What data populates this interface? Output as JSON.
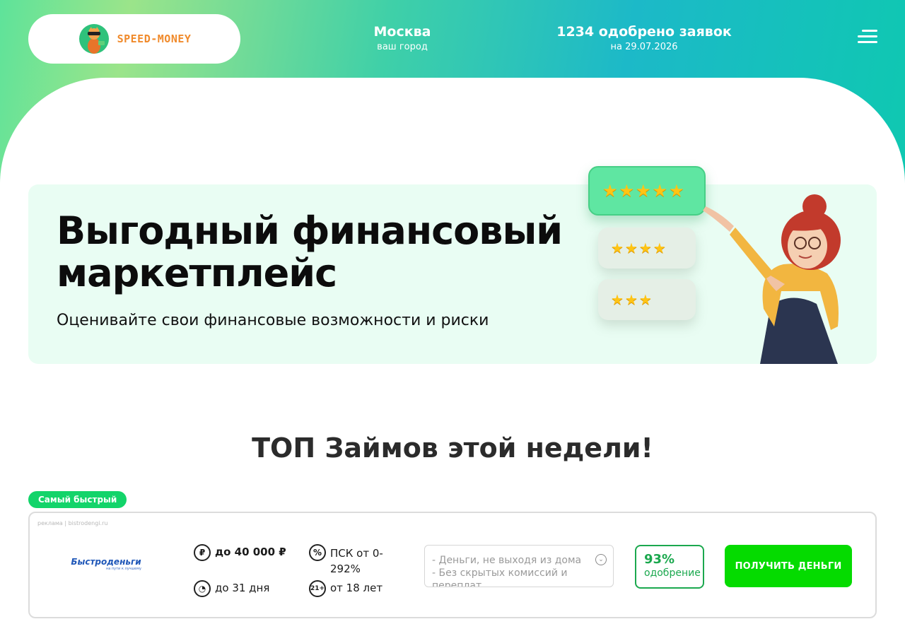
{
  "header": {
    "logo_text": "SPEED-MONEY",
    "city": {
      "name": "Москва",
      "caption": "ваш город"
    },
    "approvals": {
      "count_text": "1234 одобрено заявок",
      "date_text": "на 29.07.2026"
    },
    "menu_icon": "hamburger-icon"
  },
  "banner": {
    "title": "Выгодный финансовый маркетплейс",
    "subtitle": "Оценивайте свои финансовые возможности и риски",
    "rating_cards": [
      {
        "stars": 5
      },
      {
        "stars": 4
      },
      {
        "stars": 3
      }
    ]
  },
  "section": {
    "title": "ТОП Займов этой недели!"
  },
  "offer": {
    "badge": "Самый быстрый",
    "ad_label": "реклама | bistrodengi.ru",
    "lender_name": "Быстроденьги",
    "lender_tagline": "на пути к лучшему",
    "amount": "до 40 000 ₽",
    "term": "до 31 дня",
    "psk": "ПСК от 0-292%",
    "age": "от 18 лет",
    "features": "- Деньги, не выходя из дома\n- Без скрытых комиссий и переплат",
    "approval_percent": "93%",
    "approval_label": "одобрение",
    "cta_label": "ПОЛУЧИТЬ ДЕНЬГИ"
  },
  "colors": {
    "accent_green": "#05db00",
    "badge_green": "#13d46a",
    "approval_green": "#1ba84e",
    "logo_orange": "#f08a2b",
    "banner_bg": "#e9fdf3"
  }
}
